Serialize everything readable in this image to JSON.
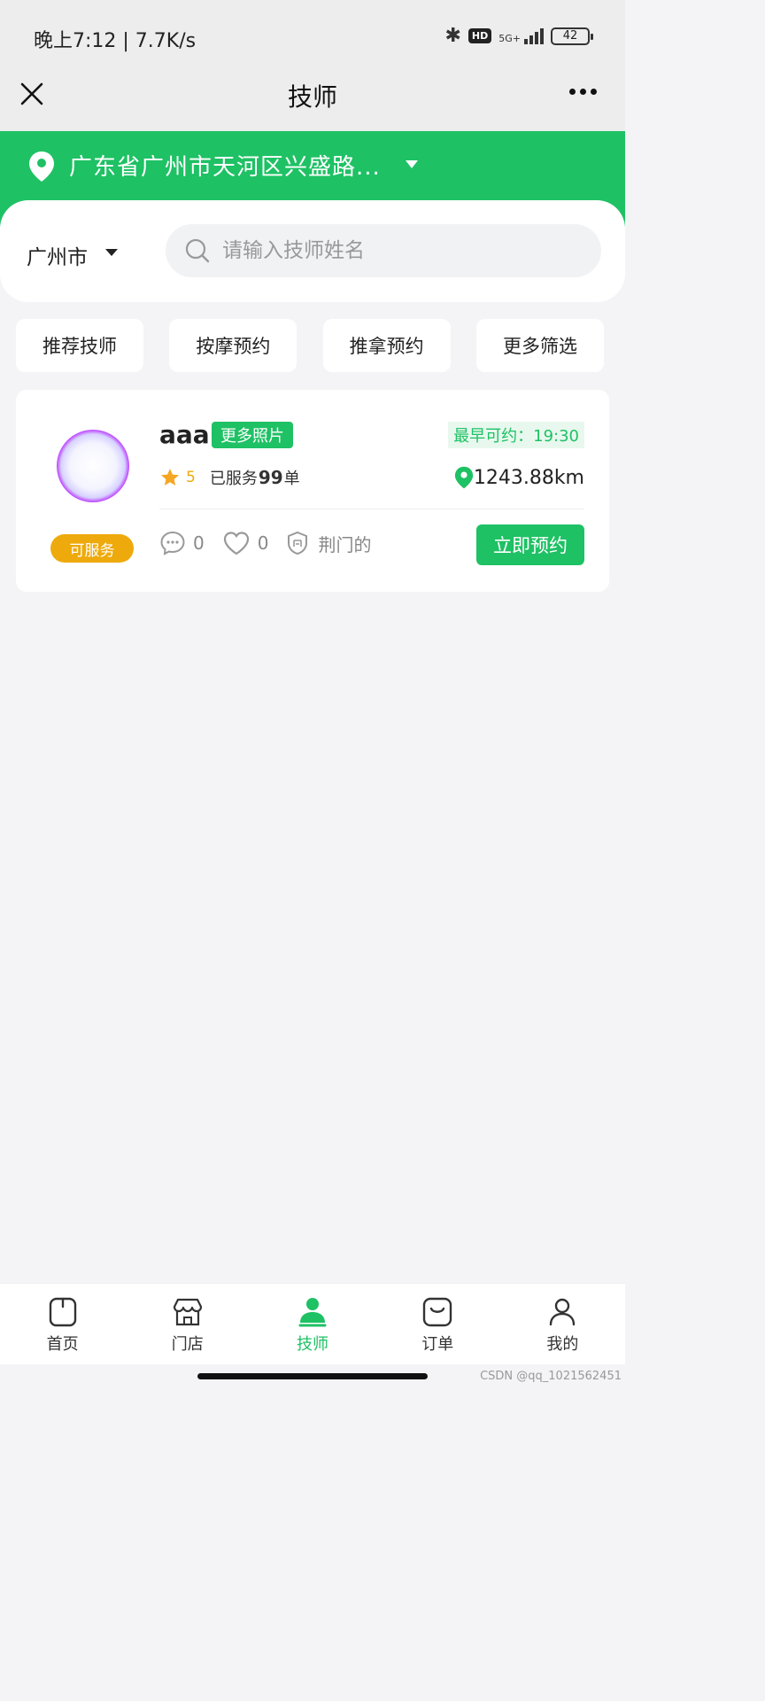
{
  "status_bar": {
    "time_speed": "晚上7:12 | 7.7K/s",
    "hd": "HD",
    "network": "5G+",
    "battery": "42"
  },
  "nav": {
    "title": "技师",
    "close_icon": "close-icon",
    "more_icon": "more-icon"
  },
  "location": {
    "address": "广东省广州市天河区兴盛路..."
  },
  "search": {
    "city": "广州市",
    "placeholder": "请输入技师姓名"
  },
  "filters": [
    "推荐技师",
    "按摩预约",
    "推拿预约",
    "更多筛选"
  ],
  "technician": {
    "name": "aaa",
    "more_photos": "更多照片",
    "earliest": "最早可约：19:30",
    "rating": "5",
    "served_prefix": "已服务",
    "served_count": "99",
    "served_suffix": "单",
    "distance": "1243.88km",
    "status": "可服务",
    "comments": "0",
    "likes": "0",
    "shop": "荆门的",
    "book_label": "立即预约"
  },
  "tabs": [
    {
      "label": "首页",
      "icon": "home-icon",
      "active": false
    },
    {
      "label": "门店",
      "icon": "store-icon",
      "active": false
    },
    {
      "label": "技师",
      "icon": "technician-icon",
      "active": true
    },
    {
      "label": "订单",
      "icon": "order-icon",
      "active": false
    },
    {
      "label": "我的",
      "icon": "profile-icon",
      "active": false
    }
  ],
  "watermark": "CSDN @qq_1021562451",
  "colors": {
    "primary": "#1ec164",
    "warning": "#eeaa0c",
    "background": "#f4f4f6"
  }
}
